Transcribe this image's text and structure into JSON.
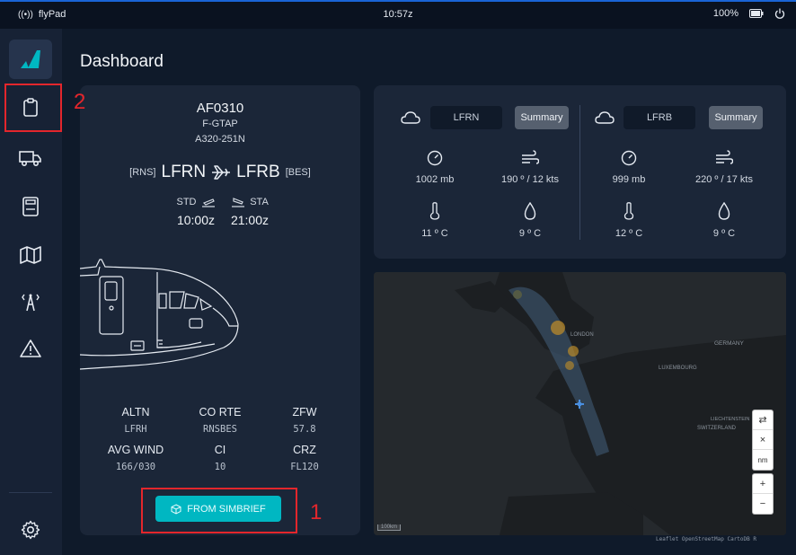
{
  "topbar": {
    "app_name": "flyPad",
    "clock": "10:57z",
    "battery": "100%"
  },
  "sidebar": {
    "items": [
      {
        "name": "logo"
      },
      {
        "name": "dispatch",
        "active": true
      },
      {
        "name": "ground"
      },
      {
        "name": "performance"
      },
      {
        "name": "navigation"
      },
      {
        "name": "atc"
      },
      {
        "name": "failures"
      },
      {
        "name": "settings"
      }
    ]
  },
  "page": {
    "title": "Dashboard"
  },
  "flight": {
    "callsign": "AF0310",
    "registration": "F-GTAP",
    "aircraft": "A320-251N",
    "origin_iata": "[RNS]",
    "origin_icao": "LFRN",
    "dest_icao": "LFRB",
    "dest_iata": "[BES]",
    "std_label": "STD",
    "sta_label": "STA",
    "std_time": "10:00z",
    "sta_time": "21:00z",
    "info": [
      {
        "label": "ALTN",
        "value": "LFRH"
      },
      {
        "label": "CO RTE",
        "value": "RNSBES"
      },
      {
        "label": "ZFW",
        "value": "57.8"
      },
      {
        "label": "AVG WIND",
        "value": "166/030"
      },
      {
        "label": "CI",
        "value": "10"
      },
      {
        "label": "CRZ",
        "value": "FL120"
      }
    ],
    "simbrief_label": "FROM SIMBRIEF"
  },
  "weather": [
    {
      "icao": "LFRN",
      "summary_label": "Summary",
      "pressure": "1002 mb",
      "wind": "190 º / 12 kts",
      "temp": "11 º C",
      "dewpoint": "9 º C"
    },
    {
      "icao": "LFRB",
      "summary_label": "Summary",
      "pressure": "999 mb",
      "wind": "220 º / 17 kts",
      "temp": "12 º C",
      "dewpoint": "9 º C"
    }
  ],
  "map": {
    "labels": [
      "LONDON",
      "GERMANY",
      "LUXEMBOURG",
      "SWITZERLAND",
      "LIECHTENSTEIN"
    ],
    "controls": [
      "⇄",
      "×",
      "nm",
      "+",
      "−"
    ],
    "scale": "100km",
    "attribution": "Leaflet OpenStreetMap CartoDB R"
  },
  "annotations": [
    {
      "number": "1"
    },
    {
      "number": "2"
    }
  ]
}
